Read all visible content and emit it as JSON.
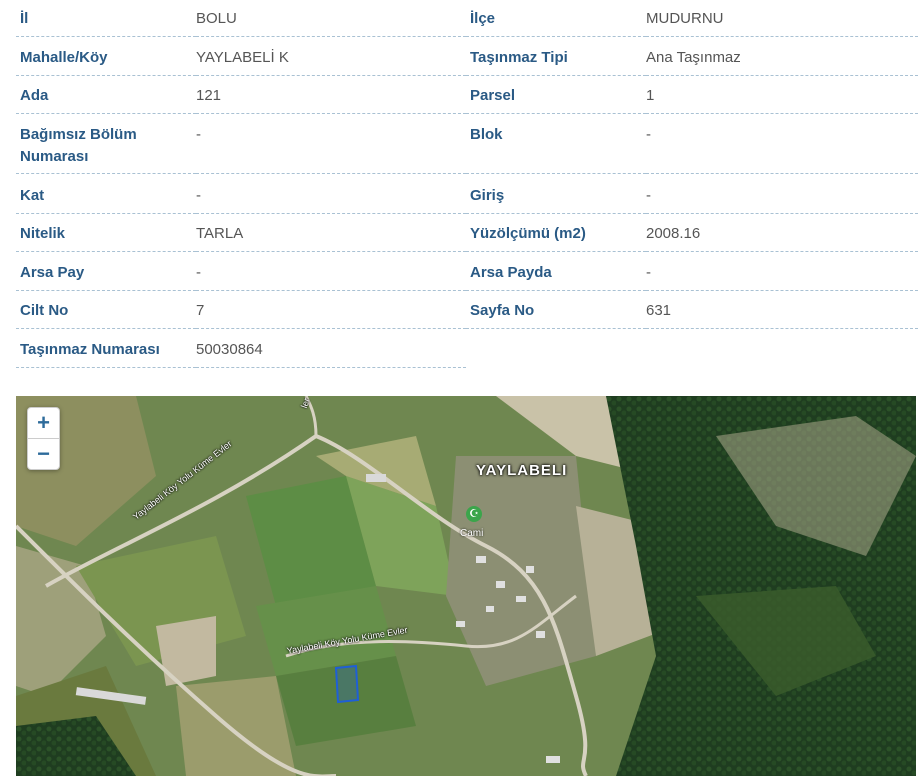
{
  "parcel_info": {
    "rows": [
      {
        "left_label": "İl",
        "left_value": "BOLU",
        "right_label": "İlçe",
        "right_value": "MUDURNU"
      },
      {
        "left_label": "Mahalle/Köy",
        "left_value": "YAYLABELİ K",
        "right_label": "Taşınmaz Tipi",
        "right_value": "Ana Taşınmaz"
      },
      {
        "left_label": "Ada",
        "left_value": "121",
        "right_label": "Parsel",
        "right_value": "1"
      },
      {
        "left_label": "Bağımsız Bölüm Numarası",
        "left_value": "-",
        "right_label": "Blok",
        "right_value": "-"
      },
      {
        "left_label": "Kat",
        "left_value": "-",
        "right_label": "Giriş",
        "right_value": "-"
      },
      {
        "left_label": "Nitelik",
        "left_value": "TARLA",
        "right_label": "Yüzölçümü (m2)",
        "right_value": "2008.16"
      },
      {
        "left_label": "Arsa Pay",
        "left_value": "-",
        "right_label": "Arsa Payda",
        "right_value": "-"
      },
      {
        "left_label": "Cilt No",
        "left_value": "7",
        "right_label": "Sayfa No",
        "right_value": "631"
      },
      {
        "left_label": "Taşınmaz Numarası",
        "left_value": "50030864",
        "right_label": "",
        "right_value": ""
      }
    ]
  },
  "map": {
    "zoom_in_label": "+",
    "zoom_out_label": "−",
    "place_name": "YAYLABELI",
    "poi_label": "Cami",
    "poi_icon": "mosque-icon",
    "road_label_1": "Yaylabeli Köy Yolu Küme Evler",
    "road_label_2": "Yaylabeli Köy Yolu Küme Evler",
    "road_label_top": "ler",
    "parcel_color": "#1f5fd6"
  }
}
